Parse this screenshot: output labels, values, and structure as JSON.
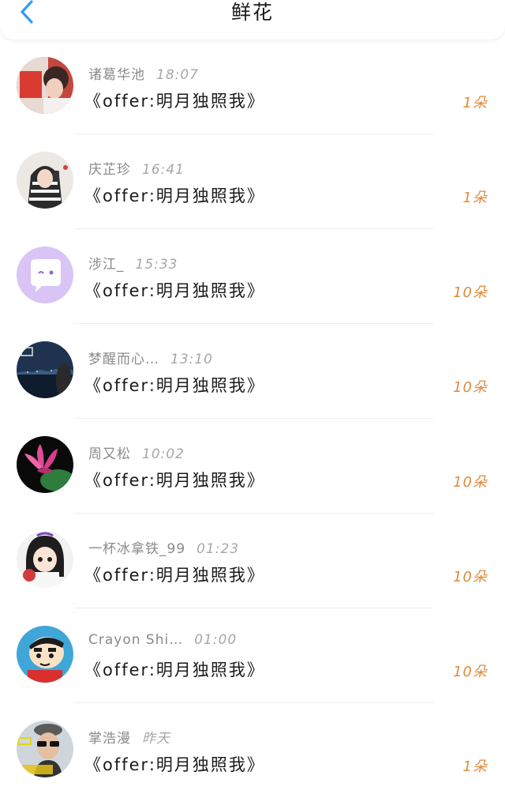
{
  "header": {
    "title": "鲜花",
    "back_icon": "chevron-left-icon"
  },
  "colors": {
    "back_icon": "#2f9bff",
    "count_text": "#e08a3b",
    "name_text": "#8a8a8a"
  },
  "items": [
    {
      "name": "诸葛华池",
      "time": "18:07",
      "book": "《offer:明月独照我》",
      "count": "1朵",
      "avatar": "red-photo-avatar"
    },
    {
      "name": "庆芷珍",
      "time": "16:41",
      "book": "《offer:明月独照我》",
      "count": "1朵",
      "avatar": "girl-in-striped-hoodie-avatar"
    },
    {
      "name": "涉江_",
      "time": "15:33",
      "book": "《offer:明月独照我》",
      "count": "10朵",
      "avatar": "purple-chat-bubble-avatar"
    },
    {
      "name": "梦醒而心…",
      "time": "13:10",
      "book": "《offer:明月独照我》",
      "count": "10朵",
      "avatar": "night-city-avatar"
    },
    {
      "name": "周又松",
      "time": "10:02",
      "book": "《offer:明月独照我》",
      "count": "10朵",
      "avatar": "pink-lotus-avatar"
    },
    {
      "name": "一杯冰拿铁_99",
      "time": "01:23",
      "book": "《offer:明月独照我》",
      "count": "10朵",
      "avatar": "anime-girl-avatar"
    },
    {
      "name": "Crayon Shi…",
      "time": "01:00",
      "book": "《offer:明月独照我》",
      "count": "10朵",
      "avatar": "crayon-shin-chan-avatar"
    },
    {
      "name": "掌浩漫",
      "time": "昨天",
      "book": "《offer:明月独照我》",
      "count": "1朵",
      "avatar": "man-with-sunglasses-avatar"
    }
  ]
}
